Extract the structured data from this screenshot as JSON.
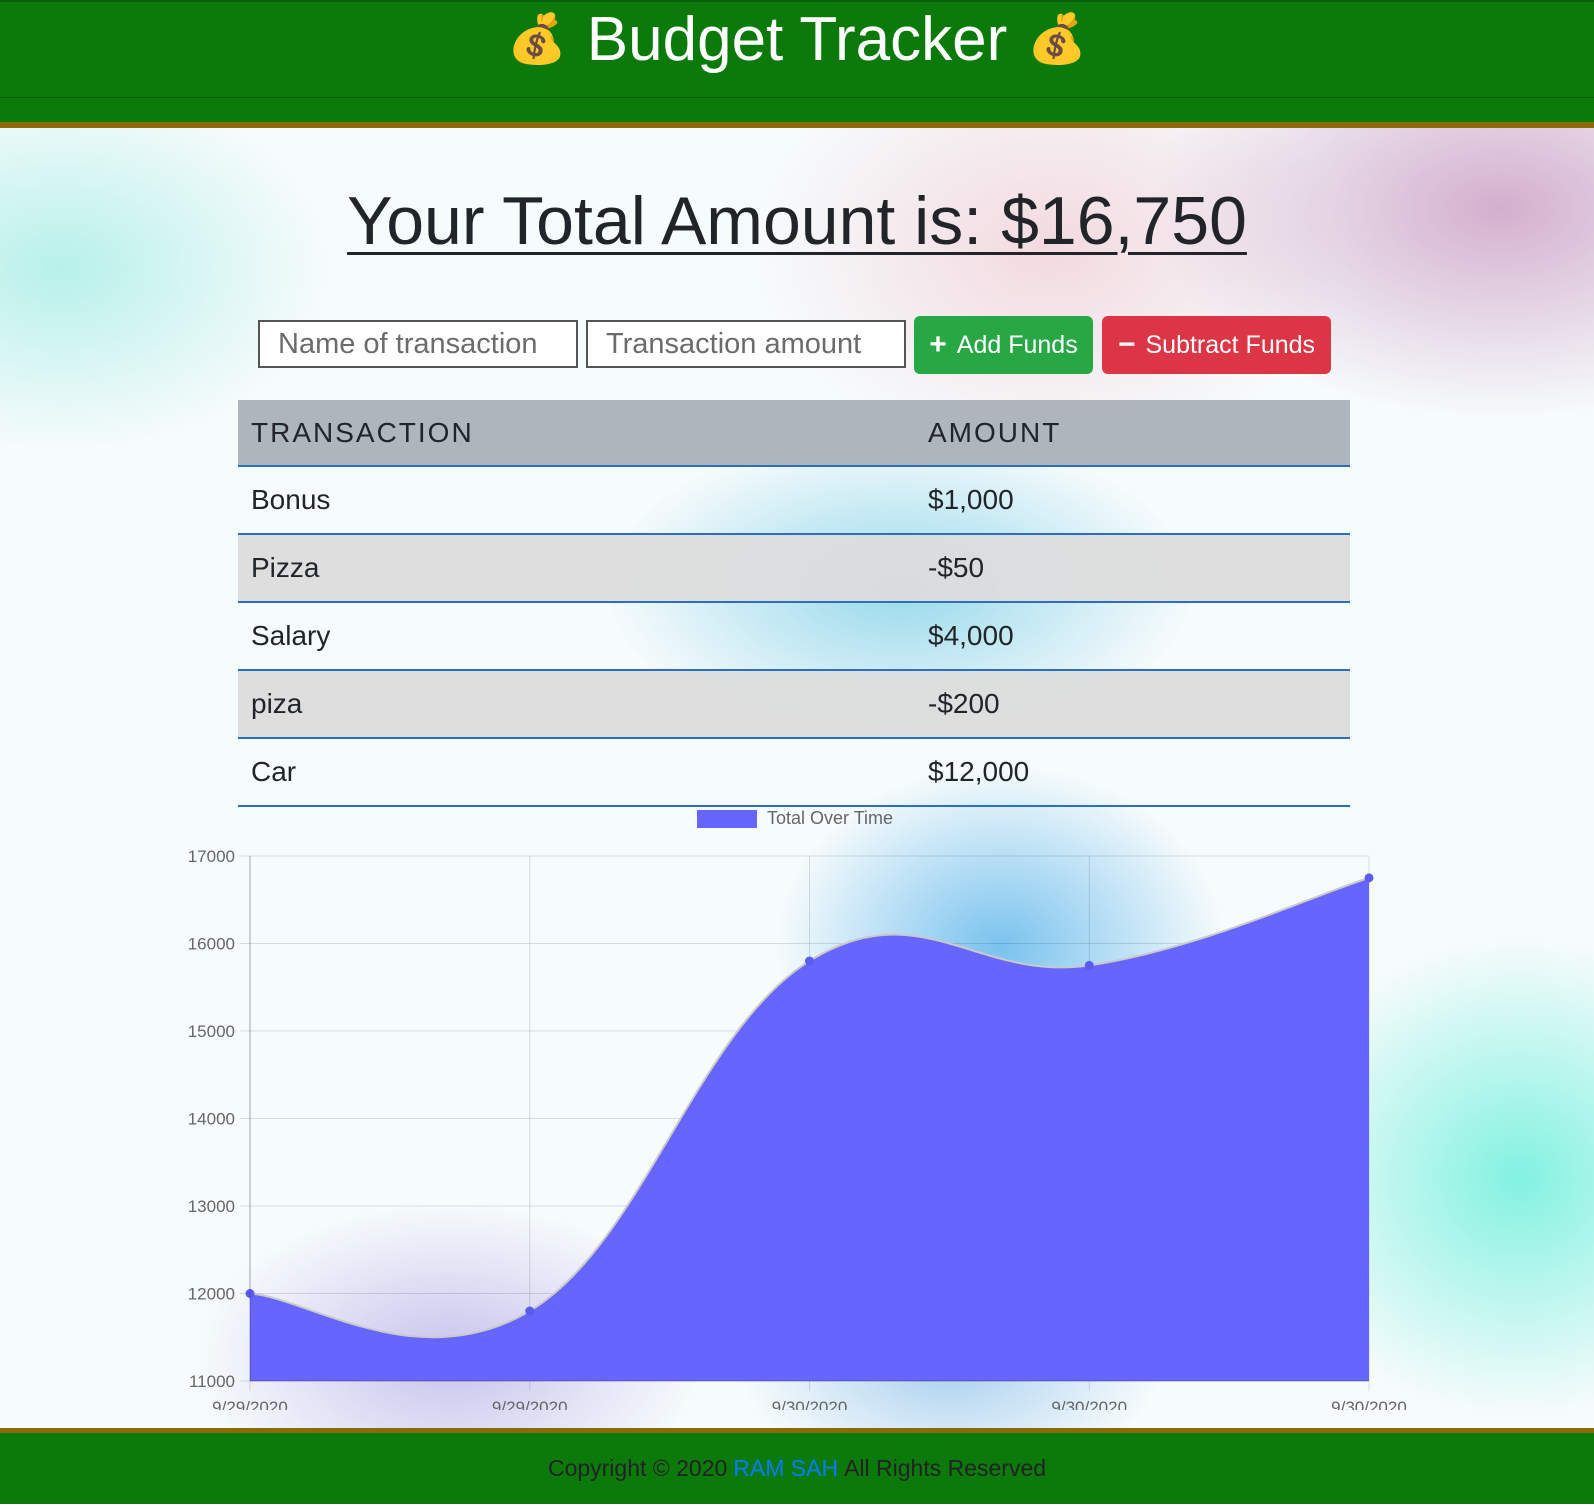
{
  "header": {
    "title": "Budget Tracker",
    "icon_left": "money-bag-icon",
    "icon_right": "money-bag-icon",
    "icon_glyph": "💰"
  },
  "summary": {
    "total_text": "Your Total Amount is: $16,750"
  },
  "form": {
    "name_placeholder": "Name of transaction",
    "amount_placeholder": "Transaction amount",
    "add_label": "Add Funds",
    "add_icon": "plus-icon",
    "subtract_label": "Subtract Funds",
    "subtract_icon": "minus-icon"
  },
  "table": {
    "headers": [
      "TRANSACTION",
      "AMOUNT"
    ],
    "rows": [
      {
        "name": "Bonus",
        "amount": "$1,000"
      },
      {
        "name": "Pizza",
        "amount": "-$50"
      },
      {
        "name": "Salary",
        "amount": "$4,000"
      },
      {
        "name": "piza",
        "amount": "-$200"
      },
      {
        "name": "Car",
        "amount": "$12,000"
      }
    ]
  },
  "chart_data": {
    "type": "area",
    "x": [
      "9/29/2020",
      "9/29/2020",
      "9/30/2020",
      "9/30/2020",
      "9/30/2020"
    ],
    "series": [
      {
        "name": "Total Over Time",
        "values": [
          12000,
          11800,
          15800,
          15750,
          16750
        ]
      }
    ],
    "ylim": [
      11000,
      17000
    ],
    "yticks": [
      11000,
      12000,
      13000,
      14000,
      15000,
      16000,
      17000
    ],
    "legend_position": "top",
    "grid": true,
    "colors": {
      "fill": "#6666ff",
      "line": "#c9c9c9",
      "point": "#5b5bf0"
    }
  },
  "footer": {
    "prefix": "Copyright © 2020",
    "author": "RAM SAH",
    "suffix": "All Rights Reserved"
  },
  "colors": {
    "header_bg": "#0b7a0b",
    "accent_line": "#8a6a0a",
    "add_button": "#28a745",
    "subtract_button": "#dc3545",
    "table_header": "#adb5bd",
    "row_border": "#2a6fc0"
  }
}
